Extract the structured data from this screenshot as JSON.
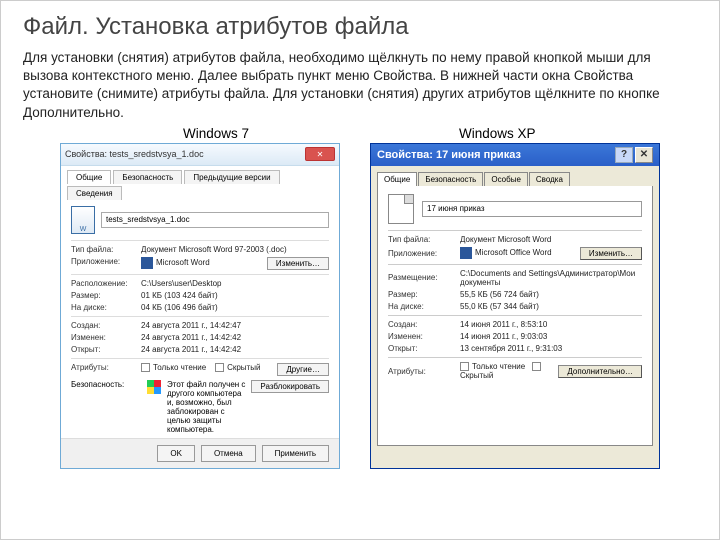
{
  "page": {
    "title": "Файл. Установка атрибутов файла",
    "description": "Для установки (снятия) атрибутов файла, необходимо щёлкнуть по нему правой кнопкой мыши для вызова контекстного меню. Далее выбрать пункт меню Свойства. В нижней части окна Свойства установите (снимите) атрибуты файла. Для установки (снятия) других атрибутов щёлкните по кнопке Дополнительно.",
    "os_left": "Windows 7",
    "os_right": "Windows XP"
  },
  "win7": {
    "window_title": "Свойства: tests_sredstvsya_1.doc",
    "close": "✕",
    "tabs": {
      "t0": "Общие",
      "t1": "Безопасность",
      "t2": "Предыдущие версии",
      "t3": "Сведения"
    },
    "filename": "tests_sredstvsya_1.doc",
    "rows": {
      "type_l": "Тип файла:",
      "type_v": "Документ Microsoft Word 97-2003 (.doc)",
      "app_l": "Приложение:",
      "app_v": "Microsoft Word",
      "app_btn": "Изменить…",
      "loc_l": "Расположение:",
      "loc_v": "C:\\Users\\user\\Desktop",
      "size_l": "Размер:",
      "size_v": "01 КБ (103 424 байт)",
      "disk_l": "На диске:",
      "disk_v": "04 КБ (106 496 байт)",
      "created_l": "Создан:",
      "created_v": "24 августа 2011 г., 14:42:47",
      "modified_l": "Изменен:",
      "modified_v": "24 августа 2011 г., 14:42:42",
      "opened_l": "Открыт:",
      "opened_v": "24 августа 2011 г., 14:42:42",
      "attr_l": "Атрибуты:",
      "attr_ro": "Только чтение",
      "attr_hidden": "Скрытый",
      "attr_btn": "Другие…",
      "sec_l": "Безопасность:",
      "sec_text": "Этот файл получен с другого компьютера и, возможно, был заблокирован с целью защиты компьютера.",
      "sec_btn": "Разблокировать"
    },
    "footer": {
      "ok": "OK",
      "cancel": "Отмена",
      "apply": "Применить"
    }
  },
  "winxp": {
    "window_title": "Свойства: 17 июня приказ",
    "help": "?",
    "close": "✕",
    "tabs": {
      "t0": "Общие",
      "t1": "Безопасность",
      "t2": "Особые",
      "t3": "Сводка"
    },
    "filename": "17 июня приказ",
    "rows": {
      "type_l": "Тип файла:",
      "type_v": "Документ Microsoft Word",
      "app_l": "Приложение:",
      "app_v": "Microsoft Office Word",
      "app_btn": "Изменить…",
      "loc_l": "Размещение:",
      "loc_v": "C:\\Documents and Settings\\Администратор\\Мои документы",
      "size_l": "Размер:",
      "size_v": "55,5 КБ (56 724 байт)",
      "disk_l": "На диске:",
      "disk_v": "55,0 КБ (57 344 байт)",
      "created_l": "Создан:",
      "created_v": "14 июня 2011 г., 8:53:10",
      "modified_l": "Изменен:",
      "modified_v": "14 июня 2011 г., 9:03:03",
      "opened_l": "Открыт:",
      "opened_v": "13 сентября 2011 г., 9:31:03",
      "attr_l": "Атрибуты:",
      "attr_ro": "Только чтение",
      "attr_hidden": "Скрытый",
      "attr_btn": "Дополнительно…"
    }
  }
}
